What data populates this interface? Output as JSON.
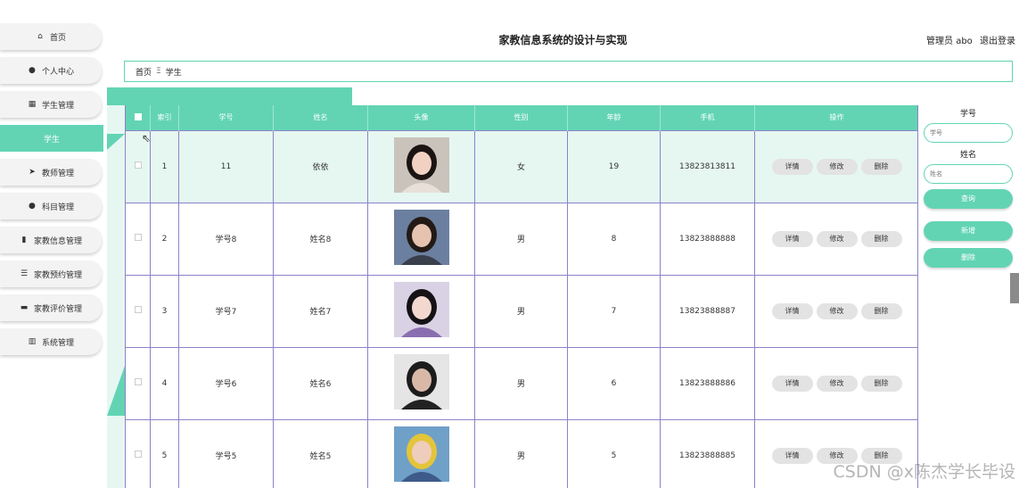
{
  "header": {
    "title": "家教信息系统的设计与实现",
    "user_label": "管理员 abo",
    "logout": "退出登录"
  },
  "sidebar": {
    "items": [
      {
        "label": "首页",
        "icon": "home-icon",
        "glyph": "⌂"
      },
      {
        "label": "个人中心",
        "icon": "user-icon",
        "glyph": "●"
      },
      {
        "label": "学生管理",
        "icon": "grid-icon",
        "glyph": "▦"
      },
      {
        "label": "学生",
        "icon": "",
        "glyph": ""
      },
      {
        "label": "教师管理",
        "icon": "send-icon",
        "glyph": "➤"
      },
      {
        "label": "科目管理",
        "icon": "user-icon",
        "glyph": "●"
      },
      {
        "label": "家教信息管理",
        "icon": "clipboard-icon",
        "glyph": "▮"
      },
      {
        "label": "家教预约管理",
        "icon": "list-icon",
        "glyph": "☰"
      },
      {
        "label": "家教评价管理",
        "icon": "monitor-icon",
        "glyph": "▬"
      },
      {
        "label": "系统管理",
        "icon": "bar-chart-icon",
        "glyph": "▥"
      }
    ],
    "active_index": 3
  },
  "breadcrumb": {
    "home": "首页",
    "separator": "Ξ",
    "current": "学生"
  },
  "table": {
    "headers": [
      "",
      "索引",
      "学号",
      "姓名",
      "头像",
      "性别",
      "年龄",
      "手机",
      "操作"
    ],
    "rows": [
      {
        "index": "1",
        "id": "11",
        "name": "依依",
        "gender": "女",
        "age": "19",
        "phone": "13823813811"
      },
      {
        "index": "2",
        "id": "学号8",
        "name": "姓名8",
        "gender": "男",
        "age": "8",
        "phone": "13823888888"
      },
      {
        "index": "3",
        "id": "学号7",
        "name": "姓名7",
        "gender": "男",
        "age": "7",
        "phone": "13823888887"
      },
      {
        "index": "4",
        "id": "学号6",
        "name": "姓名6",
        "gender": "男",
        "age": "6",
        "phone": "13823888886"
      },
      {
        "index": "5",
        "id": "学号5",
        "name": "姓名5",
        "gender": "男",
        "age": "5",
        "phone": "13823888885"
      }
    ],
    "actions": {
      "detail": "详情",
      "edit": "修改",
      "delete": "删除"
    }
  },
  "search": {
    "id_label": "学号",
    "id_placeholder": "学号",
    "name_label": "姓名",
    "name_placeholder": "姓名",
    "query_button": "查询",
    "add_button": "新增",
    "delete_button": "删除"
  },
  "watermark": "CSDN @x陈杰学长毕设",
  "colors": {
    "accent": "#62d4b4",
    "row_highlight": "#e6f7f2",
    "table_border": "#8b83c8"
  }
}
